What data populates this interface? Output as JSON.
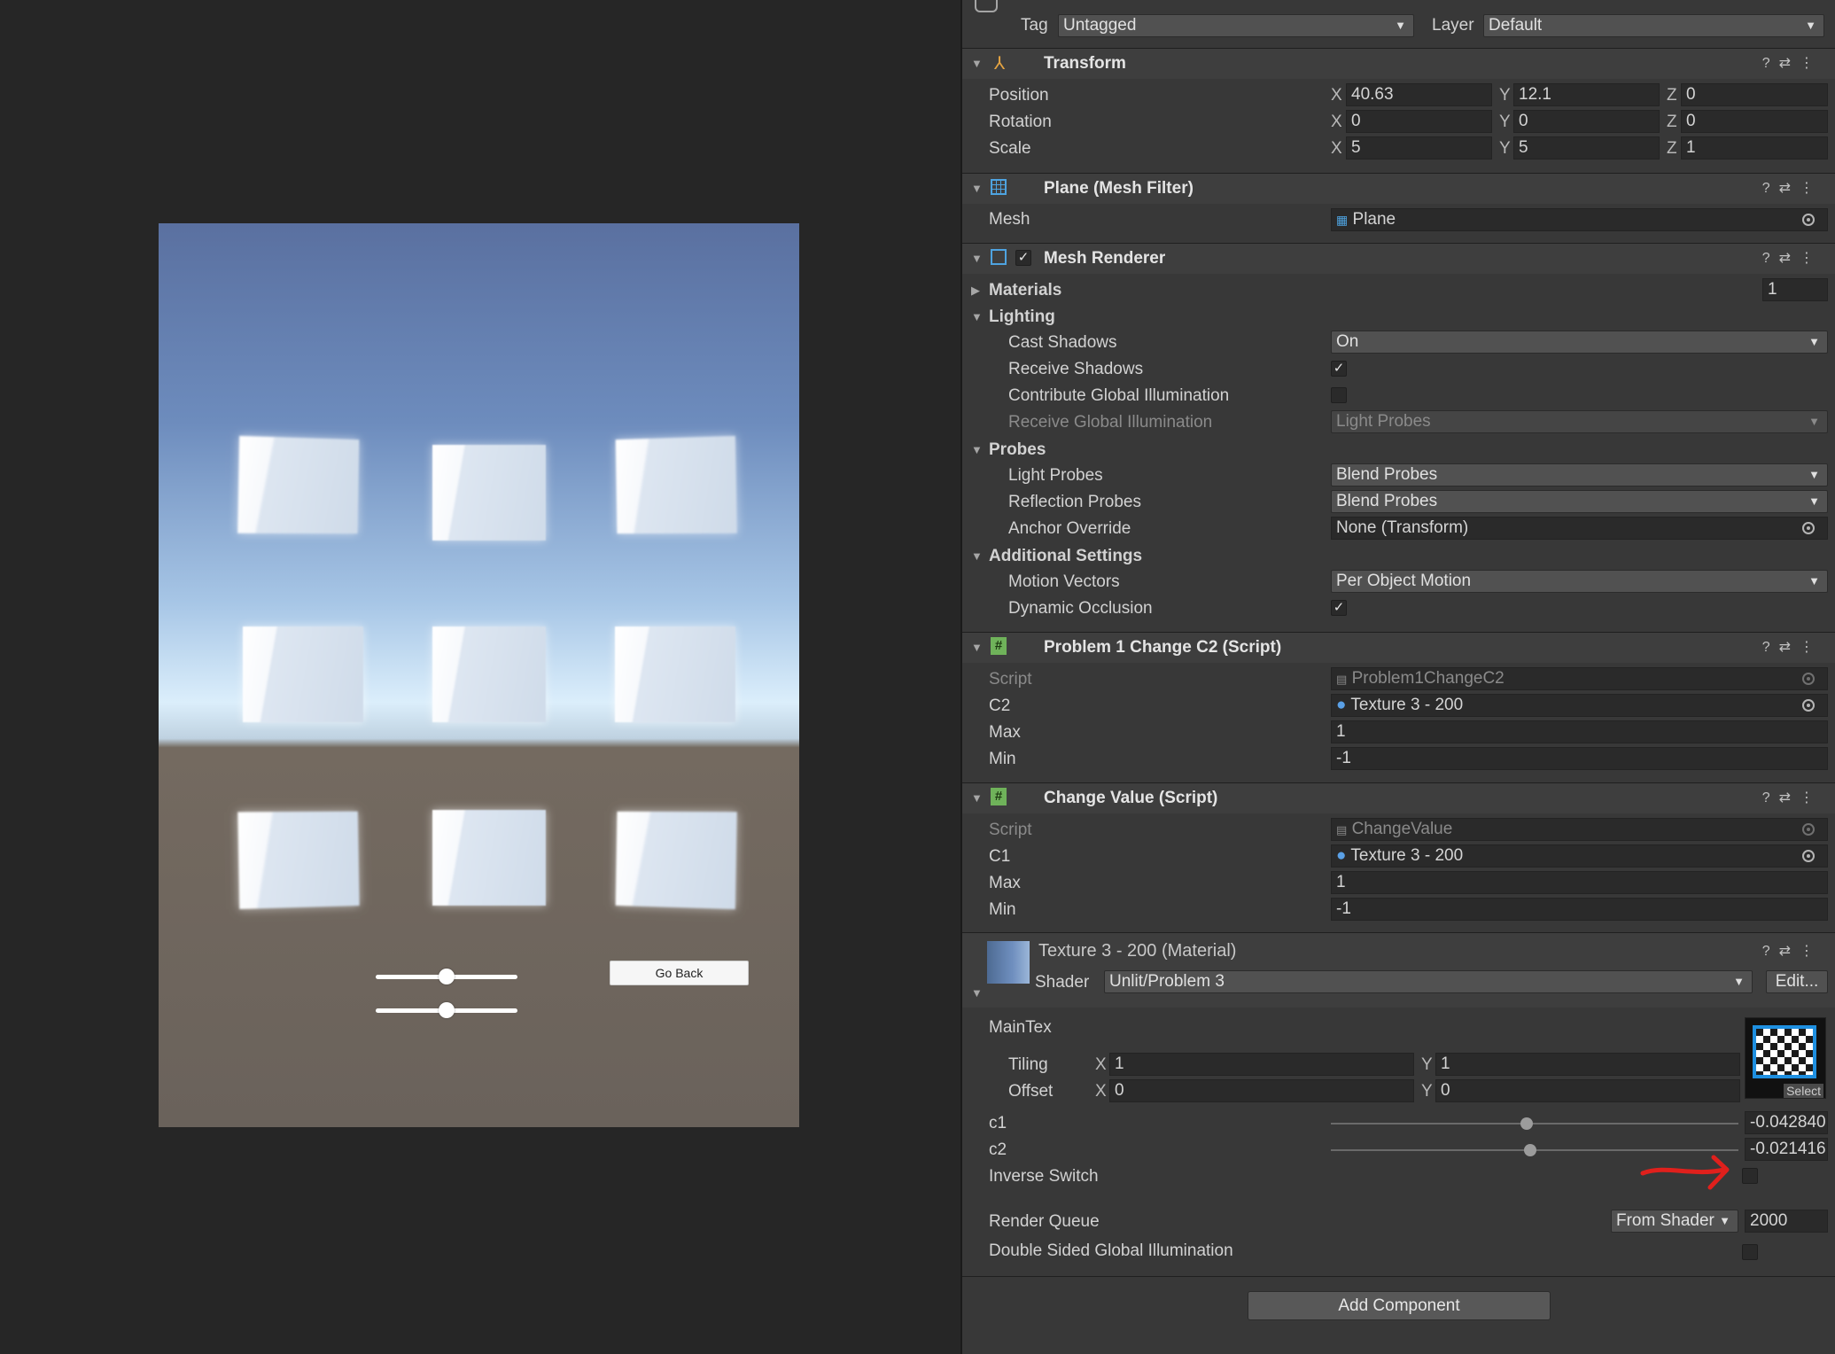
{
  "game": {
    "go_back_label": "Go Back",
    "slider_1_value": 0.5,
    "slider_2_value": 0.5
  },
  "inspector": {
    "tag_label": "Tag",
    "tag_value": "Untagged",
    "layer_label": "Layer",
    "layer_value": "Default",
    "transform": {
      "title": "Transform",
      "position_label": "Position",
      "rotation_label": "Rotation",
      "scale_label": "Scale",
      "position": {
        "x": "40.63",
        "y": "12.1",
        "z": "0"
      },
      "rotation": {
        "x": "0",
        "y": "0",
        "z": "0"
      },
      "scale": {
        "x": "5",
        "y": "5",
        "z": "1"
      }
    },
    "mesh_filter": {
      "title": "Plane (Mesh Filter)",
      "mesh_label": "Mesh",
      "mesh_value": "Plane"
    },
    "mesh_renderer": {
      "title": "Mesh Renderer",
      "materials_label": "Materials",
      "materials_count": "1",
      "lighting_label": "Lighting",
      "cast_shadows_label": "Cast Shadows",
      "cast_shadows_value": "On",
      "receive_shadows_label": "Receive Shadows",
      "contribute_gi_label": "Contribute Global Illumination",
      "receive_gi_label": "Receive Global Illumination",
      "receive_gi_value": "Light Probes",
      "probes_label": "Probes",
      "light_probes_label": "Light Probes",
      "light_probes_value": "Blend Probes",
      "reflection_probes_label": "Reflection Probes",
      "reflection_probes_value": "Blend Probes",
      "anchor_override_label": "Anchor Override",
      "anchor_override_value": "None (Transform)",
      "additional_settings_label": "Additional Settings",
      "motion_vectors_label": "Motion Vectors",
      "motion_vectors_value": "Per Object Motion",
      "dynamic_occlusion_label": "Dynamic Occlusion"
    },
    "problem1": {
      "title": "Problem 1 Change C2 (Script)",
      "script_label": "Script",
      "script_value": "Problem1ChangeC2",
      "c2_label": "C2",
      "c2_value": "Texture 3 - 200",
      "max_label": "Max",
      "max_value": "1",
      "min_label": "Min",
      "min_value": "-1"
    },
    "change_value": {
      "title": "Change Value (Script)",
      "script_label": "Script",
      "script_value": "ChangeValue",
      "c1_label": "C1",
      "c1_value": "Texture 3 - 200",
      "max_label": "Max",
      "max_value": "1",
      "min_label": "Min",
      "min_value": "-1"
    },
    "material": {
      "title": "Texture 3 - 200 (Material)",
      "shader_label": "Shader",
      "shader_value": "Unlit/Problem 3",
      "edit_label": "Edit...",
      "maintex_label": "MainTex",
      "tiling_label": "Tiling",
      "offset_label": "Offset",
      "tiling": {
        "x": "1",
        "y": "1"
      },
      "offset": {
        "x": "0",
        "y": "0"
      },
      "select_label": "Select",
      "c1_label": "c1",
      "c1_value": "-0.042840",
      "c1_level": 0.48,
      "c2_label": "c2",
      "c2_value": "-0.021416",
      "c2_level": 0.49,
      "inverse_switch_label": "Inverse Switch",
      "render_queue_label": "Render Queue",
      "render_queue_mode": "From Shader",
      "render_queue_value": "2000",
      "double_sided_gi_label": "Double Sided Global Illumination"
    },
    "add_component_label": "Add Component",
    "axis_x": "X",
    "axis_y": "Y",
    "axis_z": "Z",
    "annotation_color": "#e0201c"
  }
}
